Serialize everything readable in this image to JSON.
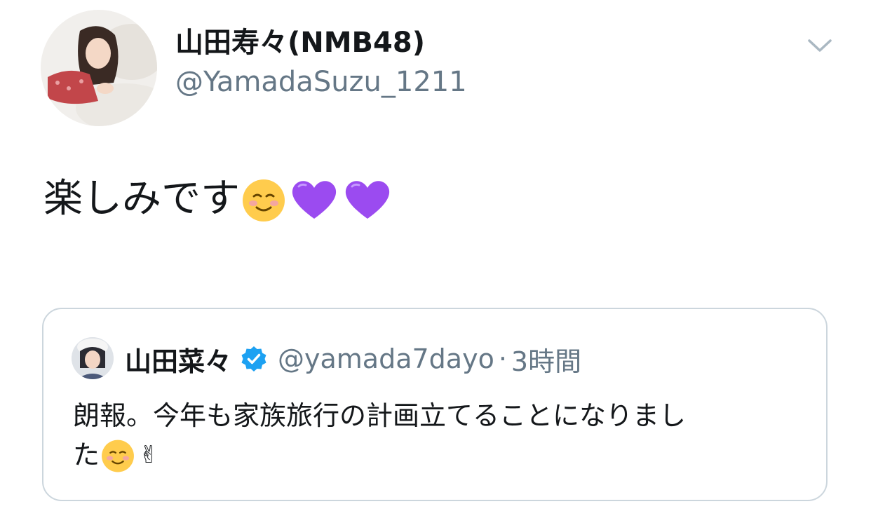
{
  "author": {
    "display_name": "山田寿々(NMB48)",
    "handle": "@YamadaSuzu_1211"
  },
  "tweet": {
    "text": "楽しみです",
    "emojis": [
      "smiling-face-icon",
      "purple-heart-icon",
      "purple-heart-icon"
    ]
  },
  "quoted_tweet": {
    "author_name": "山田菜々",
    "verified": true,
    "handle": "@yamada7dayo",
    "separator": "·",
    "time": "3時間",
    "text_line1": "朗報。今年も家族旅行の計画立てることになりまし",
    "text_line2": "た",
    "text_line2_symbol": "✌",
    "emojis": [
      "smiling-face-icon",
      "victory-hand-icon"
    ]
  },
  "colors": {
    "primary_text": "#14171a",
    "secondary_text": "#657786",
    "border": "#ccd6dd",
    "verified_blue": "#1da1f2",
    "purple_heart": "#9b4bf0",
    "emoji_yellow": "#ffcc4d"
  }
}
